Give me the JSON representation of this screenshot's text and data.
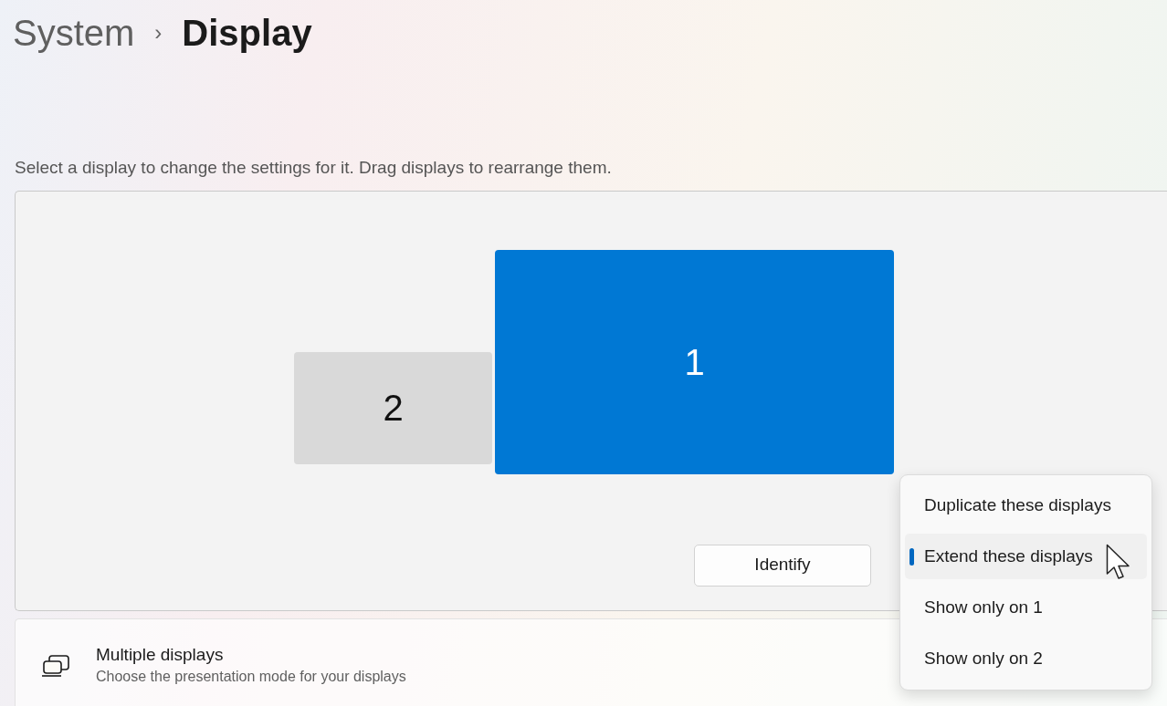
{
  "breadcrumb": {
    "parent": "System",
    "separator": "›",
    "current": "Display"
  },
  "instruction": "Select a display to change the settings for it. Drag displays to rearrange them.",
  "displays": [
    {
      "label": "2",
      "selected": false
    },
    {
      "label": "1",
      "selected": true
    }
  ],
  "identify_button": "Identify",
  "menu": [
    {
      "label": "Duplicate these displays",
      "selected": false
    },
    {
      "label": "Extend these displays",
      "selected": true
    },
    {
      "label": "Show only on 1",
      "selected": false
    },
    {
      "label": "Show only on 2",
      "selected": false
    }
  ],
  "multiple_displays": {
    "title": "Multiple displays",
    "subtitle": "Choose the presentation mode for your displays"
  }
}
